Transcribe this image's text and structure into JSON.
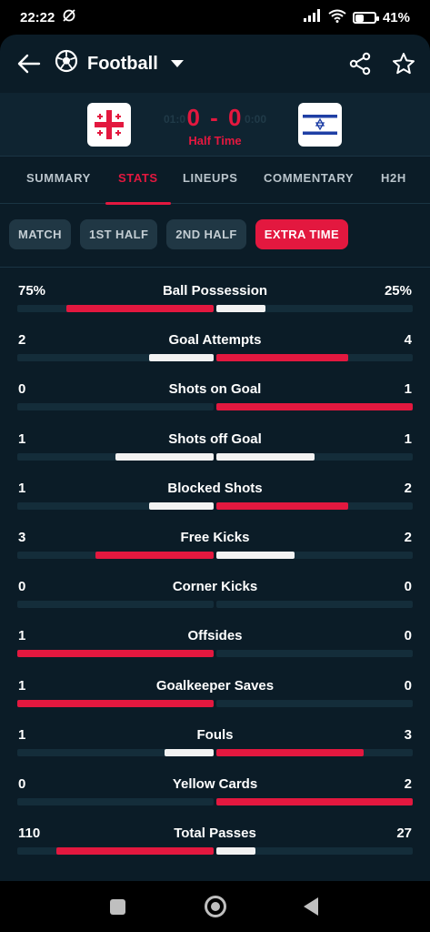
{
  "status": {
    "time": "22:22",
    "battery": "41%"
  },
  "header": {
    "sport": "Football",
    "icons": {
      "back": "back-arrow-icon",
      "sport": "football-icon",
      "share": "share-icon",
      "favorite": "star-icon"
    }
  },
  "match": {
    "home_flag": "Georgia flag",
    "away_flag": "Israel flag",
    "score": "0 - 0",
    "period": "Half Time",
    "ghost_left": "01:0",
    "ghost_right": "0:00"
  },
  "tabs": [
    {
      "label": "SUMMARY",
      "active": false
    },
    {
      "label": "STATS",
      "active": true
    },
    {
      "label": "LINEUPS",
      "active": false
    },
    {
      "label": "COMMENTARY",
      "active": false
    },
    {
      "label": "H2H",
      "active": false
    }
  ],
  "period_filters": [
    {
      "label": "MATCH",
      "active": false
    },
    {
      "label": "1ST HALF",
      "active": false
    },
    {
      "label": "2ND HALF",
      "active": false
    },
    {
      "label": "EXTRA TIME",
      "active": true
    }
  ],
  "colors": {
    "accent": "#e3183f",
    "background": "#0b1c27",
    "track": "#142d3a"
  },
  "stats": [
    {
      "name": "Ball Possession",
      "home": "75%",
      "away": "25%",
      "home_share": 0.75,
      "away_share": 0.25,
      "home_color": "red",
      "away_color": "white"
    },
    {
      "name": "Goal Attempts",
      "home": "2",
      "away": "4",
      "home_share": 0.33,
      "away_share": 0.67,
      "home_color": "white",
      "away_color": "red"
    },
    {
      "name": "Shots on Goal",
      "home": "0",
      "away": "1",
      "home_share": 0,
      "away_share": 1,
      "home_color": "white",
      "away_color": "red"
    },
    {
      "name": "Shots off Goal",
      "home": "1",
      "away": "1",
      "home_share": 0.5,
      "away_share": 0.5,
      "home_color": "white",
      "away_color": "white"
    },
    {
      "name": "Blocked Shots",
      "home": "1",
      "away": "2",
      "home_share": 0.33,
      "away_share": 0.67,
      "home_color": "white",
      "away_color": "red"
    },
    {
      "name": "Free Kicks",
      "home": "3",
      "away": "2",
      "home_share": 0.6,
      "away_share": 0.4,
      "home_color": "red",
      "away_color": "white"
    },
    {
      "name": "Corner Kicks",
      "home": "0",
      "away": "0",
      "home_share": 0,
      "away_share": 0,
      "home_color": "white",
      "away_color": "white"
    },
    {
      "name": "Offsides",
      "home": "1",
      "away": "0",
      "home_share": 1,
      "away_share": 0,
      "home_color": "red",
      "away_color": "white"
    },
    {
      "name": "Goalkeeper Saves",
      "home": "1",
      "away": "0",
      "home_share": 1,
      "away_share": 0,
      "home_color": "red",
      "away_color": "white"
    },
    {
      "name": "Fouls",
      "home": "1",
      "away": "3",
      "home_share": 0.25,
      "away_share": 0.75,
      "home_color": "white",
      "away_color": "red"
    },
    {
      "name": "Yellow Cards",
      "home": "0",
      "away": "2",
      "home_share": 0,
      "away_share": 1,
      "home_color": "white",
      "away_color": "red"
    },
    {
      "name": "Total Passes",
      "home": "110",
      "away": "27",
      "home_share": 0.8,
      "away_share": 0.2,
      "home_color": "red",
      "away_color": "white"
    }
  ],
  "system_nav": {
    "recents": "recents-square-icon",
    "home": "home-circle-icon",
    "back": "back-triangle-icon"
  }
}
